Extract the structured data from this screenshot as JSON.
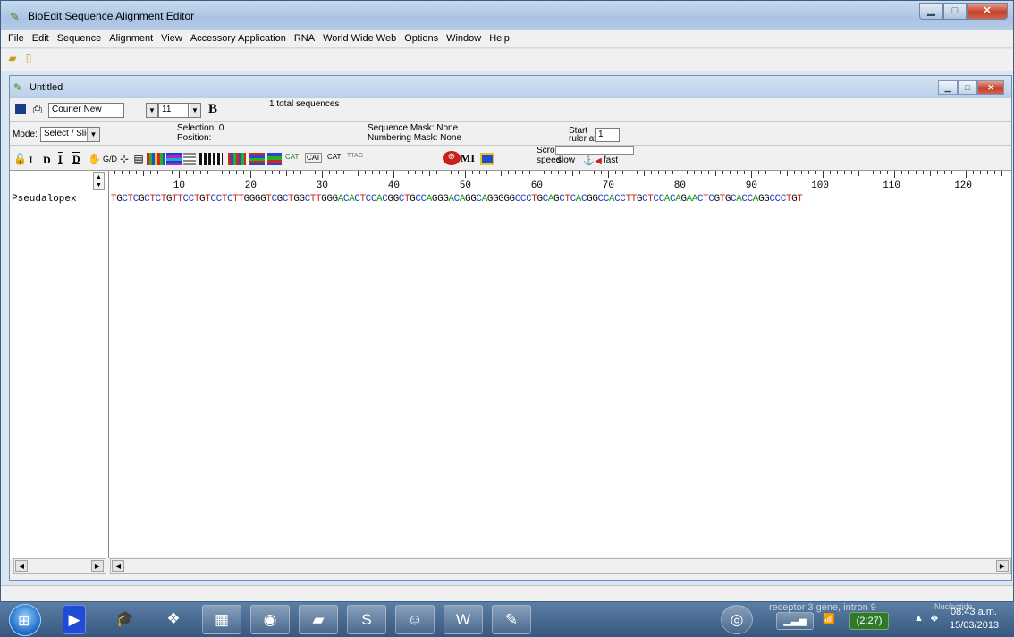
{
  "app": {
    "title": "BioEdit Sequence Alignment Editor",
    "menu": [
      "File",
      "Edit",
      "Sequence",
      "Alignment",
      "View",
      "Accessory Application",
      "RNA",
      "World Wide Web",
      "Options",
      "Window",
      "Help"
    ],
    "toolbar_icons": [
      "open-folder-icon",
      "new-document-icon"
    ]
  },
  "doc": {
    "title": "Untitled",
    "font_name": "Courier New",
    "font_size": "11",
    "bold_label": "B",
    "total_sequences": "1 total sequences",
    "mode_label": "Mode:",
    "mode_value": "Select / Slide",
    "selection": "Selection: 0",
    "position": "Position:",
    "sequence_mask": "Sequence Mask: None",
    "numbering_mask": "Numbering Mask: None",
    "start_label": "Start",
    "ruler_at": "ruler at:",
    "ruler_start_value": "1",
    "scroll_label": "Scroll",
    "speed_label": "speed",
    "slow_label": "slow",
    "fast_label": "fast",
    "mi_label": "MI",
    "tool_letters": [
      "I",
      "D",
      "I",
      "D"
    ],
    "gd_label": "G/D"
  },
  "ruler": {
    "ticks": [
      "10",
      "20",
      "30",
      "40",
      "50",
      "60",
      "70",
      "80",
      "90",
      "100",
      "110",
      "120"
    ]
  },
  "sequences": [
    {
      "name": "Pseudalopex",
      "residues": "TGCTCGCTCTGTTCCTGTCCTCTTGGGGTCGCTGGCTTGGGACACTCCACGGCTGCCAGGGACAGGCAGGGGGCCCTGCAGCTCACGGCCACCTTGCTCCACAGAACTCGTGCACCAGGCCCTGT"
    }
  ],
  "colors": {
    "T": "#d02010",
    "C": "#2040c0",
    "G": "#101010",
    "A": "#18a018"
  },
  "taskbar": {
    "ghost_text": "receptor 3 gene, intron 9",
    "ghost_text2": "Nucleotide",
    "battery": "(2:27)",
    "time": "08:43 a.m.",
    "date": "15/03/2013",
    "apps": [
      "media-player-icon",
      "graduation-icon",
      "dropbox-icon",
      "file-explorer-icon",
      "chrome-icon",
      "folder-icon",
      "skype-icon",
      "people-icon",
      "word-icon",
      "bioedit-icon"
    ]
  }
}
